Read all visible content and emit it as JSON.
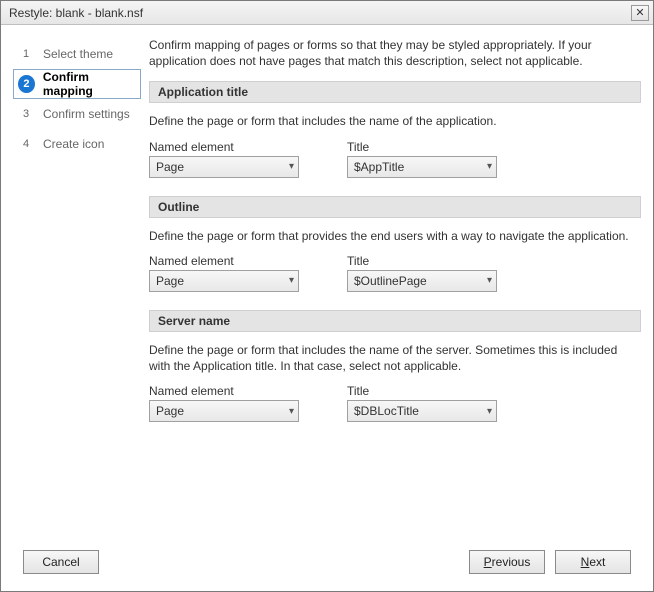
{
  "window": {
    "title": "Restyle: blank - blank.nsf"
  },
  "steps": [
    {
      "num": "1",
      "label": "Select theme"
    },
    {
      "num": "2",
      "label": "Confirm mapping"
    },
    {
      "num": "3",
      "label": "Confirm settings"
    },
    {
      "num": "4",
      "label": "Create icon"
    }
  ],
  "intro": "Confirm mapping of pages or forms so that they may be styled appropriately. If your application does not have pages that match this description, select not applicable.",
  "sections": {
    "app_title": {
      "heading": "Application title",
      "desc": "Define the page or form that includes the name of the application.",
      "named_label": "Named element",
      "named_value": "Page",
      "title_label": "Title",
      "title_value": "$AppTitle"
    },
    "outline": {
      "heading": "Outline",
      "desc": "Define the page or form that provides the end users with a way to navigate the application.",
      "named_label": "Named element",
      "named_value": "Page",
      "title_label": "Title",
      "title_value": "$OutlinePage"
    },
    "server_name": {
      "heading": "Server name",
      "desc": "Define the page or form that includes the name of the server. Sometimes this is included with the Application title.  In that case, select not applicable.",
      "named_label": "Named element",
      "named_value": "Page",
      "title_label": "Title",
      "title_value": "$DBLocTitle"
    }
  },
  "buttons": {
    "cancel": "Cancel",
    "previous_u": "P",
    "previous_rest": "revious",
    "next_u": "N",
    "next_rest": "ext"
  }
}
